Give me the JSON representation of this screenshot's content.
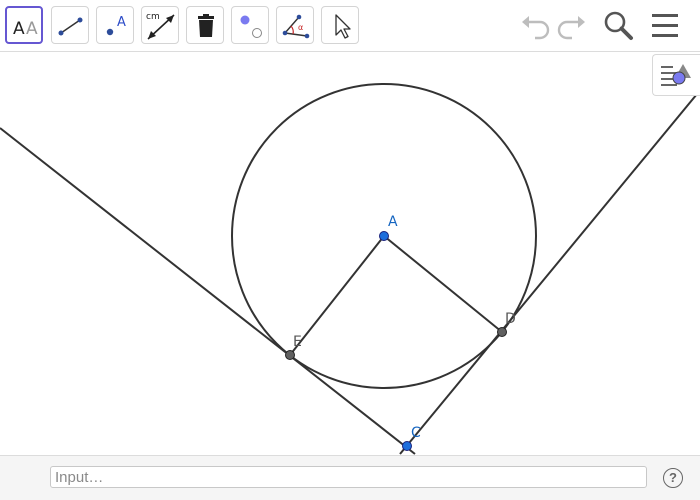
{
  "toolbar": {
    "tools": [
      {
        "name": "Style bar",
        "icon": "style-bar-icon",
        "glyph_a1": "A",
        "glyph_a2": "A"
      },
      {
        "name": "Segment",
        "icon": "segment-icon"
      },
      {
        "name": "Point",
        "icon": "point-icon",
        "label": "A"
      },
      {
        "name": "Segment with given length",
        "icon": "segment-length-icon",
        "label": "cm"
      },
      {
        "name": "Delete",
        "icon": "trash-icon"
      },
      {
        "name": "Show / hide object",
        "icon": "show-hide-icon"
      },
      {
        "name": "Angle",
        "icon": "angle-icon",
        "label": "α"
      },
      {
        "name": "Move",
        "icon": "cursor-icon"
      }
    ],
    "header_buttons": [
      "undo-icon",
      "redo-icon",
      "search-icon",
      "menu-icon"
    ]
  },
  "canvas": {
    "points": {
      "A": {
        "label": "A",
        "color": "#1565c0"
      },
      "C": {
        "label": "C",
        "color": "#1565c0"
      },
      "D": {
        "label": "D",
        "color": "#555555"
      },
      "E": {
        "label": "E",
        "color": "#555555"
      }
    }
  },
  "input_bar": {
    "placeholder": "Input…",
    "help_label": "?"
  },
  "colors": {
    "accent": "#6557d2",
    "free_point": "#1e6fdc",
    "dependent_point": "#606060",
    "stroke": "#333333"
  }
}
